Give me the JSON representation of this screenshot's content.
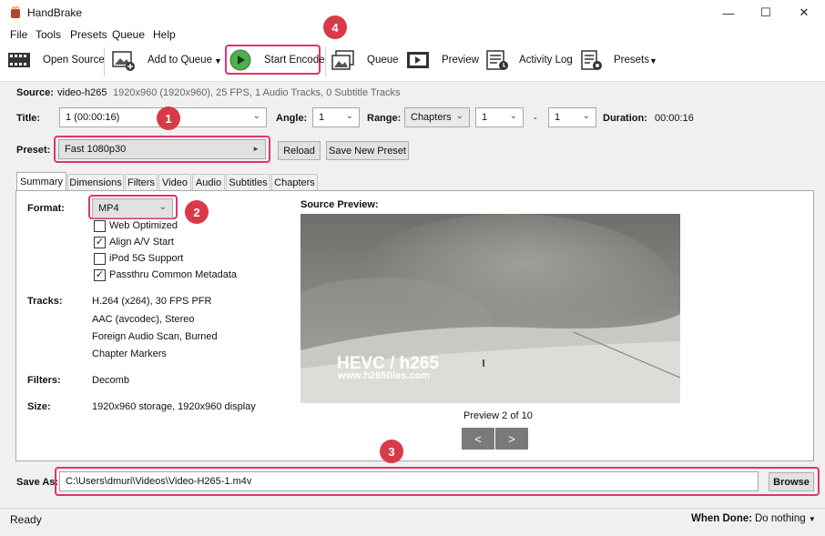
{
  "window": {
    "title": "HandBrake",
    "minimize": "—",
    "maximize": "☐",
    "close": "✕"
  },
  "menu": [
    "File",
    "Tools",
    "Presets",
    "Queue",
    "Help"
  ],
  "toolbar": {
    "open_source": "Open Source",
    "add_to_queue": "Add to Queue",
    "start_encode": "Start Encode",
    "queue": "Queue",
    "preview": "Preview",
    "activity_log": "Activity Log",
    "presets": "Presets"
  },
  "annotations": {
    "one": "1",
    "two": "2",
    "three": "3",
    "four": "4"
  },
  "source": {
    "label": "Source:",
    "name": "video-h265",
    "info": "1920x960 (1920x960), 25 FPS, 1 Audio Tracks, 0 Subtitle Tracks"
  },
  "title_row": {
    "title_label": "Title:",
    "title_value": "1  (00:00:16)",
    "angle_label": "Angle:",
    "angle_value": "1",
    "range_label": "Range:",
    "range_type": "Chapters",
    "range_start": "1",
    "range_sep": "-",
    "range_end": "1",
    "duration_label": "Duration:",
    "duration_value": "00:00:16"
  },
  "preset": {
    "label": "Preset:",
    "value": "Fast 1080p30",
    "reload": "Reload",
    "save_new": "Save New Preset"
  },
  "tabs": [
    "Summary",
    "Dimensions",
    "Filters",
    "Video",
    "Audio",
    "Subtitles",
    "Chapters"
  ],
  "summary": {
    "format_label": "Format:",
    "format_value": "MP4",
    "options": [
      {
        "label": "Web Optimized",
        "checked": false,
        "mark": ""
      },
      {
        "label": "Align A/V Start",
        "checked": true,
        "mark": "✓"
      },
      {
        "label": "iPod 5G Support",
        "checked": false,
        "mark": ""
      },
      {
        "label": "Passthru Common Metadata",
        "checked": true,
        "mark": "✓"
      }
    ],
    "tracks_label": "Tracks:",
    "tracks": [
      "H.264 (x264), 30 FPS PFR",
      "AAC (avcodec), Stereo",
      "Foreign Audio Scan, Burned",
      "Chapter Markers"
    ],
    "filters_label": "Filters:",
    "filters_value": "Decomb",
    "size_label": "Size:",
    "size_value": "1920x960 storage, 1920x960 display",
    "source_preview_label": "Source Preview:",
    "preview_overlay_title": "HEVC / h265",
    "preview_overlay_url": "www.h265files.com",
    "preview_counter": "Preview 2 of 10",
    "prev_btn": "<",
    "next_btn": ">"
  },
  "save_as": {
    "label": "Save As:",
    "path": "C:\\Users\\dmuri\\Videos\\Video-H265-1.m4v",
    "browse": "Browse"
  },
  "status": {
    "text": "Ready",
    "when_done_label": "When Done:",
    "when_done_value": "Do nothing"
  },
  "colors": {
    "highlight": "#e3336b",
    "badge": "#d83a4a",
    "play": "#4caf50"
  }
}
